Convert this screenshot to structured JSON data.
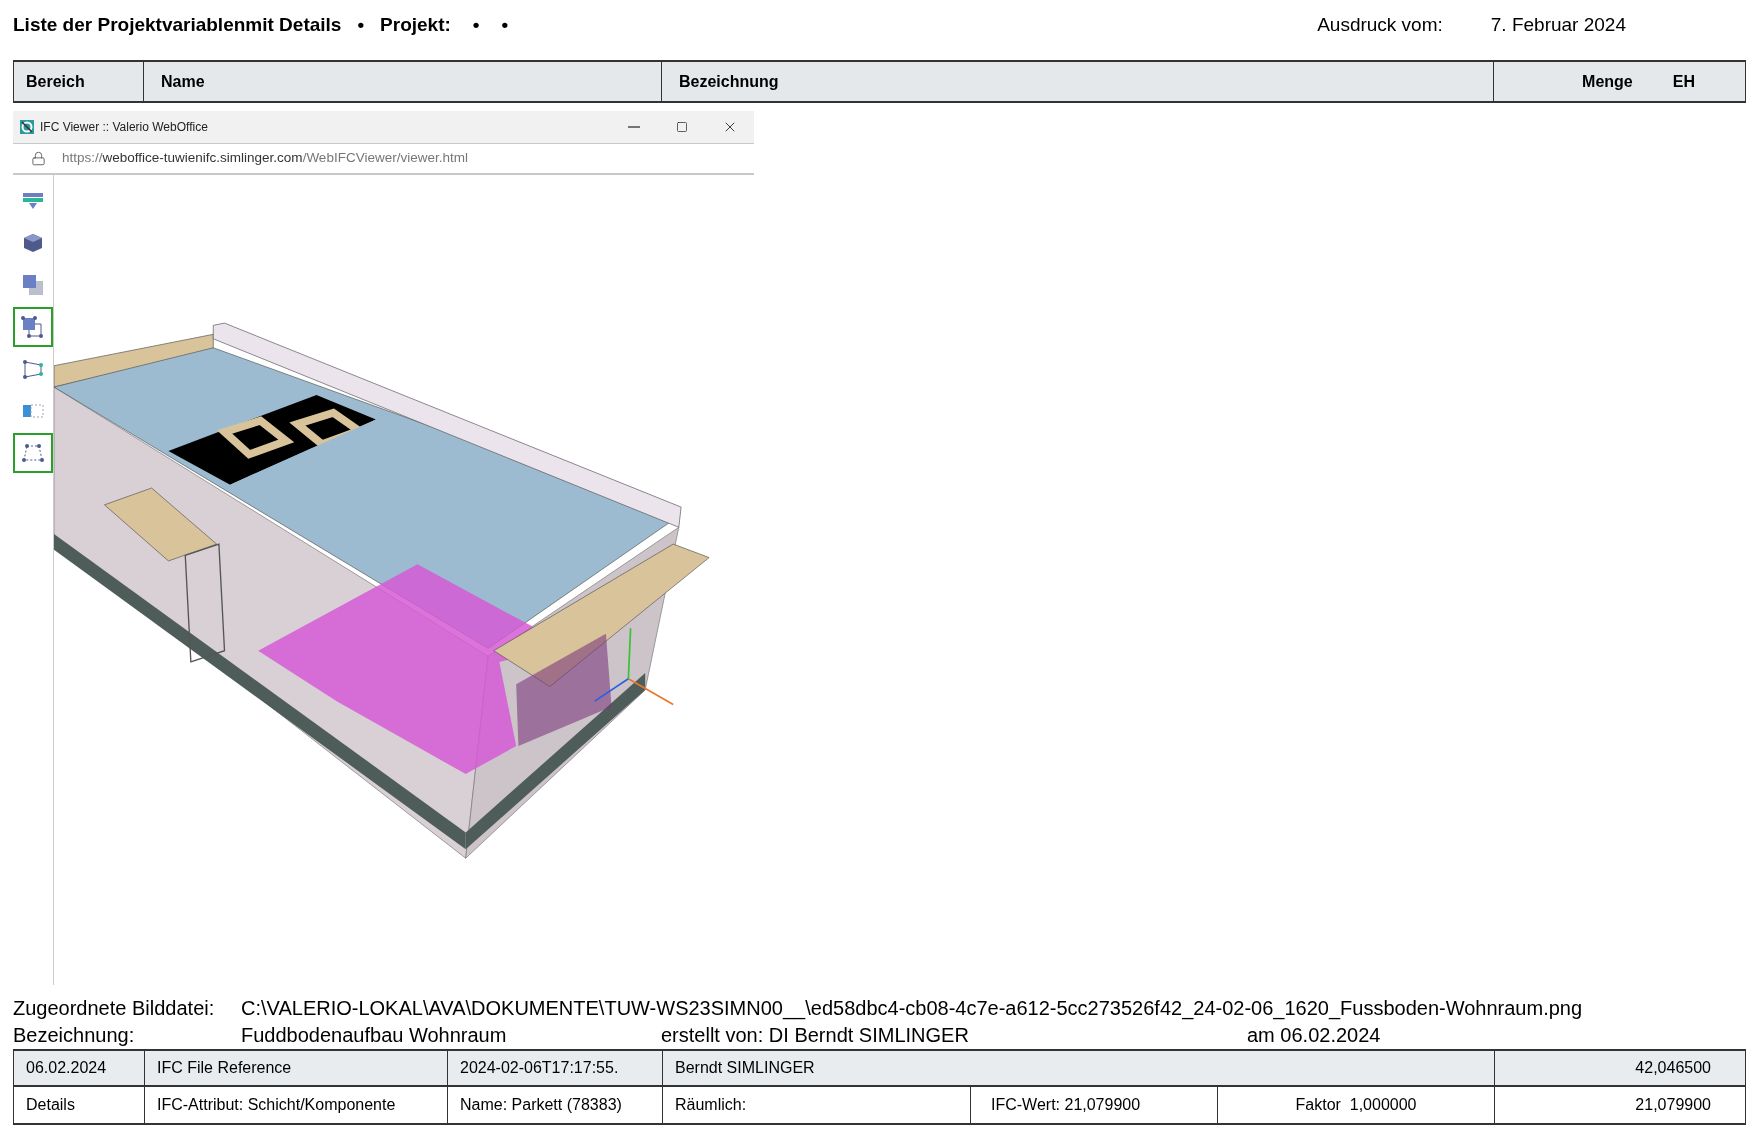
{
  "header": {
    "title": "Liste der Projektvariablenmit Details",
    "separator": "•",
    "project_label": "Projekt:",
    "project_values": [
      "•",
      "•"
    ],
    "print_label": "Ausdruck vom:",
    "print_date": "7. Februar 2024"
  },
  "table_header": {
    "columns": [
      "Bereich",
      "Name",
      "Bezeichnung",
      "Menge",
      "EH"
    ]
  },
  "viewer_window": {
    "title": "IFC Viewer :: Valerio WebOffice",
    "url_scheme": "https://",
    "url_host": "weboffice-tuwienifc.simlinger.com",
    "url_path": "/WebIFCViewer/viewer.html",
    "tools": [
      {
        "kind": "clip",
        "selected": false
      },
      {
        "kind": "cube",
        "selected": false
      },
      {
        "kind": "layers",
        "selected": false
      },
      {
        "kind": "select",
        "selected": true
      },
      {
        "kind": "polygon",
        "selected": false
      },
      {
        "kind": "split",
        "selected": false
      },
      {
        "kind": "corners",
        "selected": true
      }
    ]
  },
  "image_info": {
    "file_label": "Zugeordnete Bilddatei:",
    "file_path": "C:\\VALERIO-LOKAL\\AVA\\DOKUMENTE\\TUW-WS23SIMN00__\\ed58dbc4-cb08-4c7e-a612-5cc273526f42_24-02-06_1620_Fussboden-Wohnraum.png",
    "name_label": "Bezeichnung:",
    "name_value": "Fuddbodenaufbau Wohnraum",
    "author": "erstellt von: DI Berndt SIMLINGER",
    "date": "am 06.02.2024"
  },
  "rows": [
    {
      "kind": "summary",
      "cells": [
        "06.02.2024",
        "IFC File Reference",
        "2024-02-06T17:17:55.",
        "Berndt SIMLINGER",
        "42,046500"
      ]
    },
    {
      "kind": "detail",
      "cells": [
        "Details",
        "IFC-Attribut: Schicht/Komponente",
        "Name: Parkett (78383)",
        "Räumlich:",
        "IFC-Wert: 21,079900",
        "Faktor  1,000000",
        "21,079900"
      ]
    }
  ]
}
